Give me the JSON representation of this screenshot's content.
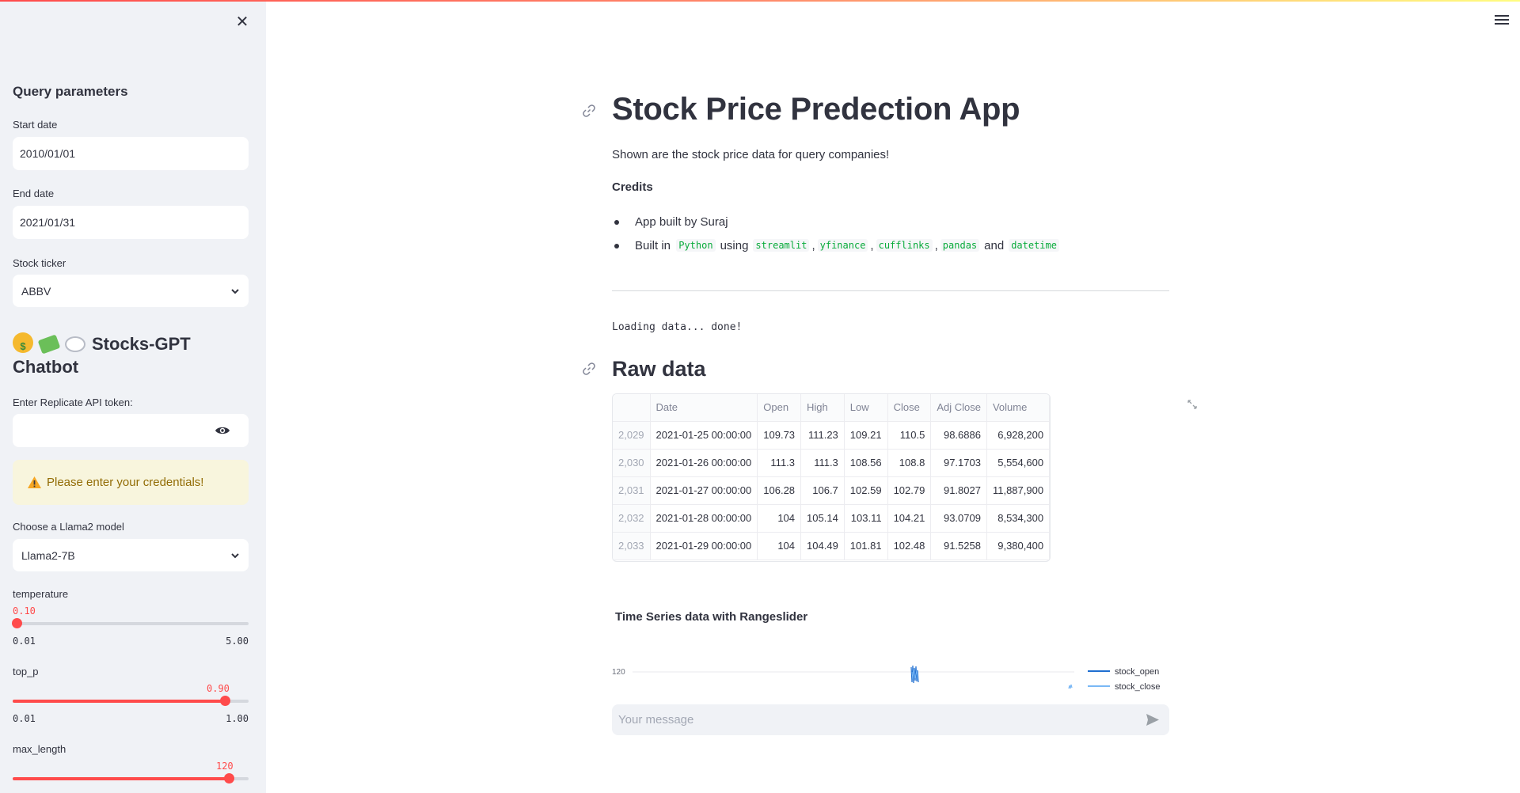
{
  "sidebar": {
    "query_heading": "Query parameters",
    "start_date_label": "Start date",
    "start_date_value": "2010/01/01",
    "end_date_label": "End date",
    "end_date_value": "2021/01/31",
    "ticker_label": "Stock ticker",
    "ticker_value": "ABBV",
    "bot_title": "Stocks-GPT Chatbot",
    "bot_title_emojis": [
      "money-mouth-face-icon",
      "money-with-wings-icon",
      "speech-bubble-icon"
    ],
    "api_token_label": "Enter Replicate API token:",
    "api_token_value": "",
    "warning_text": "Please enter your credentials!",
    "model_label": "Choose a Llama2 model",
    "model_value": "Llama2-7B",
    "sliders": [
      {
        "label": "temperature",
        "value": "0.10",
        "min": "0.01",
        "max": "5.00",
        "fraction": 0.018
      },
      {
        "label": "top_p",
        "value": "0.90",
        "min": "0.01",
        "max": "1.00",
        "fraction": 0.899
      },
      {
        "label": "max_length",
        "value": "120",
        "fraction": 0.915
      }
    ]
  },
  "main": {
    "title": "Stock Price Predection App",
    "lead": "Shown are the stock price data for query companies!",
    "credits_heading": "Credits",
    "bullet_1": "App built by Suraj",
    "bullet_2_prefix": "Built in",
    "bullet_2_python": "Python",
    "bullet_2_using": "using",
    "bullet_2_libs": [
      "streamlit",
      "yfinance",
      "cufflinks",
      "pandas"
    ],
    "bullet_2_and": "and",
    "bullet_2_last": "datetime",
    "loading_text": "Loading data... done!",
    "raw_data_heading": "Raw data",
    "table": {
      "columns": [
        "",
        "Date",
        "Open",
        "High",
        "Low",
        "Close",
        "Adj Close",
        "Volume"
      ],
      "rows": [
        [
          "2,029",
          "2021-01-25 00:00:00",
          "109.73",
          "111.23",
          "109.21",
          "110.5",
          "98.6886",
          "6,928,200"
        ],
        [
          "2,030",
          "2021-01-26 00:00:00",
          "111.3",
          "111.3",
          "108.56",
          "108.8",
          "97.1703",
          "5,554,600"
        ],
        [
          "2,031",
          "2021-01-27 00:00:00",
          "106.28",
          "106.7",
          "102.59",
          "102.79",
          "91.8027",
          "11,887,900"
        ],
        [
          "2,032",
          "2021-01-28 00:00:00",
          "104",
          "105.14",
          "103.11",
          "104.21",
          "93.0709",
          "8,534,300"
        ],
        [
          "2,033",
          "2021-01-29 00:00:00",
          "104",
          "104.49",
          "101.81",
          "102.48",
          "91.5258",
          "9,380,400"
        ]
      ]
    },
    "chart_heading": "Time Series data with Rangeslider",
    "chat_placeholder": "Your message"
  },
  "chart_data": {
    "type": "line",
    "title": "Time Series data with Rangeslider",
    "y_tick_labels": [
      "120"
    ],
    "series": [
      {
        "name": "stock_open",
        "color": "#1f6fd1"
      },
      {
        "name": "stock_close",
        "color": "#7ab8f5"
      }
    ],
    "legend": "right",
    "grid": true
  },
  "colors": {
    "accent": "#ff4b4b",
    "sidebar_bg": "#f0f2f6",
    "code_green": "#09ab3b",
    "warning_bg": "#f8f5dd",
    "warning_text": "#926c05"
  }
}
